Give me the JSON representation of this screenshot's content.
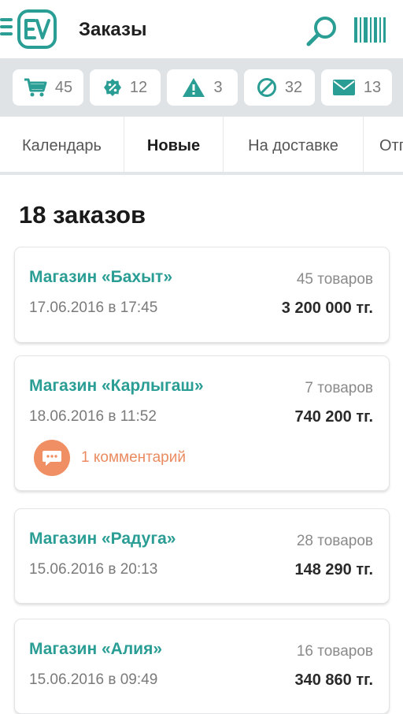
{
  "header": {
    "title": "Заказы"
  },
  "counters": [
    {
      "icon": "cart-icon",
      "value": "45"
    },
    {
      "icon": "percent-badge-icon",
      "value": "12"
    },
    {
      "icon": "warning-icon",
      "value": "3"
    },
    {
      "icon": "cancel-icon",
      "value": "32"
    },
    {
      "icon": "envelope-icon",
      "value": "13"
    }
  ],
  "tabs": [
    {
      "label": "Календарь",
      "active": false
    },
    {
      "label": "Новые",
      "active": true
    },
    {
      "label": "На доставке",
      "active": false
    },
    {
      "label": "Отг",
      "active": false
    }
  ],
  "orders_heading": "18 заказов",
  "orders": [
    {
      "shop": "Магазин «Бахыт»",
      "date": "17.06.2016 в 17:45",
      "items": "45 товаров",
      "total": "3 200 000 тг."
    },
    {
      "shop": "Магазин «Карлыгаш»",
      "date": "18.06.2016 в 11:52",
      "items": "7 товаров",
      "total": "740 200 тг.",
      "comment": "1 комментарий"
    },
    {
      "shop": "Магазин «Радуга»",
      "date": "15.06.2016 в 20:13",
      "items": "28 товаров",
      "total": "148 290 тг."
    },
    {
      "shop": "Магазин «Алия»",
      "date": "15.06.2016 в 09:49",
      "items": "16 товаров",
      "total": "340 860 тг."
    }
  ],
  "colors": {
    "accent": "#2a9d94",
    "comment": "#f08f63",
    "counters_bg": "#dfe3e6"
  }
}
